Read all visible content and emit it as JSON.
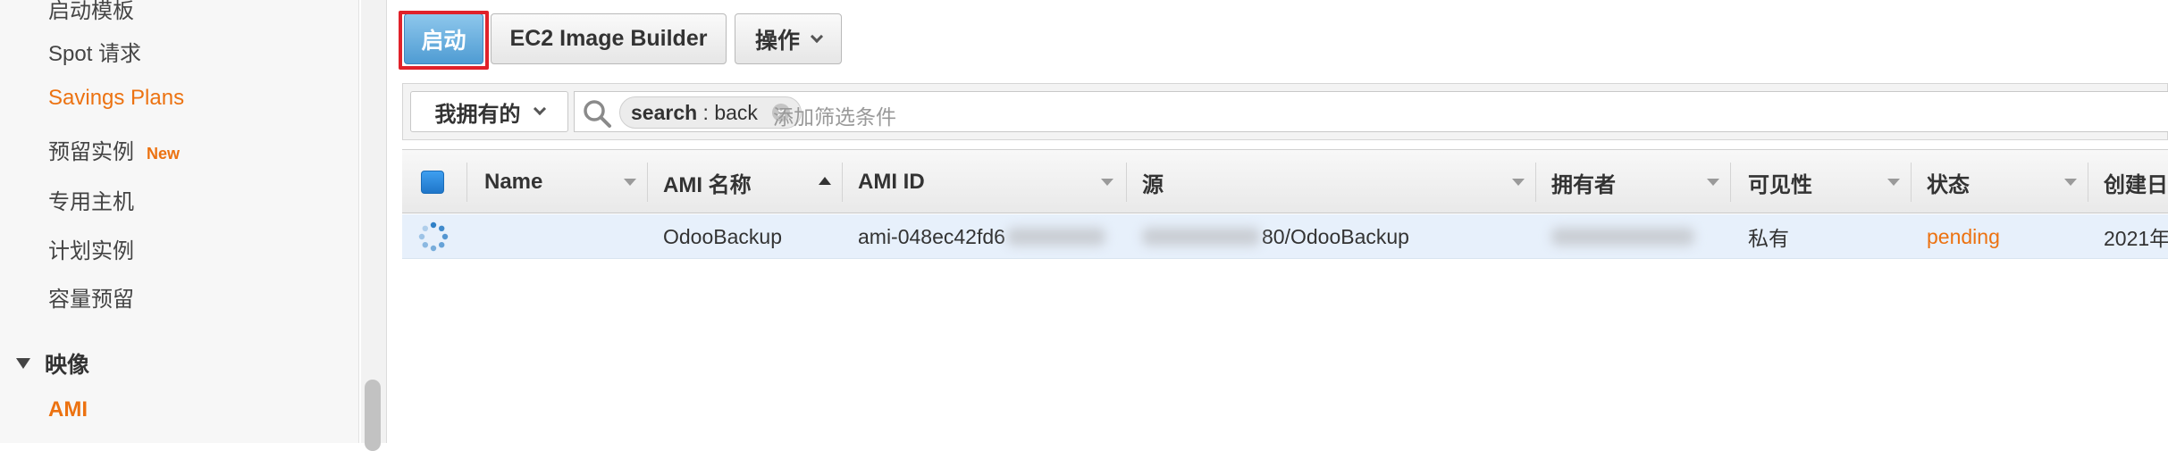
{
  "sidebar": {
    "items": [
      {
        "label": "启动模板"
      },
      {
        "label": "Spot 请求"
      },
      {
        "label": "Savings Plans"
      },
      {
        "label": "预留实例",
        "badge": "New"
      },
      {
        "label": "专用主机"
      },
      {
        "label": "计划实例"
      },
      {
        "label": "容量预留"
      }
    ],
    "section": {
      "label": "映像"
    },
    "active_item": {
      "label": "AMI"
    }
  },
  "toolbar": {
    "launch_label": "启动",
    "ec2_image_builder_label": "EC2 Image Builder",
    "actions_label": "操作"
  },
  "filter": {
    "owner_dropdown": "我拥有的",
    "token_key": "search",
    "token_sep": " : ",
    "token_value": "back",
    "placeholder": "添加筛选条件"
  },
  "table": {
    "columns": [
      "Name",
      "AMI 名称",
      "AMI ID",
      "源",
      "拥有者",
      "可见性",
      "状态",
      "创建日"
    ],
    "sorted_column": "AMI 名称",
    "rows": [
      {
        "name": "",
        "ami_name": "OdooBackup",
        "ami_id": "ami-048ec42fd6",
        "source": "80/OdooBackup",
        "owner": "",
        "visibility": "私有",
        "status": "pending",
        "created": "2021年"
      }
    ]
  },
  "colors": {
    "accent_orange": "#ec7211",
    "primary_blue": "#4f9cd3",
    "highlight_red": "#e0212a"
  }
}
